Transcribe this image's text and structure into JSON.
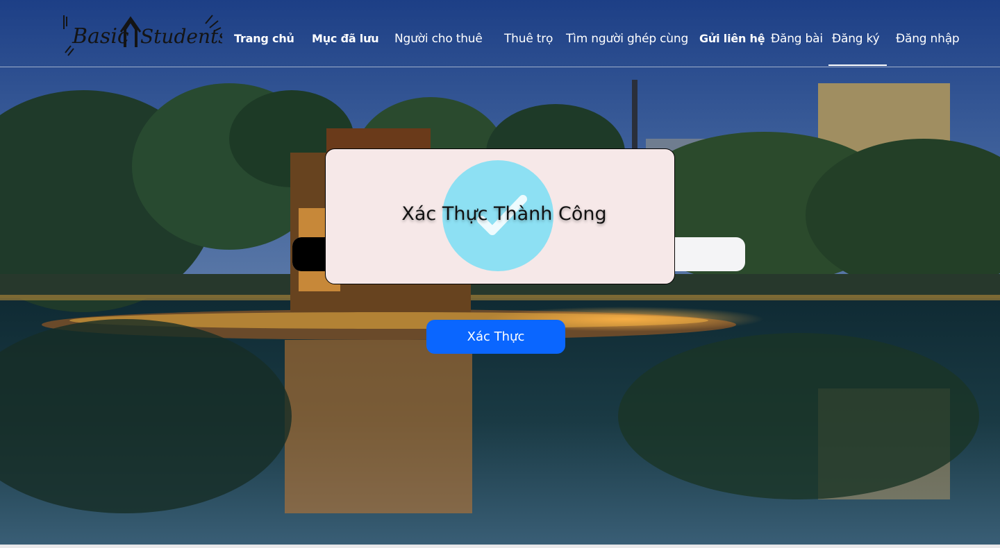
{
  "brand": {
    "logo_text": "Basic Students",
    "logo_icon": "house-icon"
  },
  "nav": {
    "items": [
      {
        "label": "Trang chủ",
        "bold": true
      },
      {
        "label": "Mục đã lưu",
        "bold": true
      },
      {
        "label": "Người cho thuê",
        "bold": false
      },
      {
        "label": "Thuê trọ",
        "bold": false
      },
      {
        "label": "Tìm người ghép cùng",
        "bold": false
      },
      {
        "label": "Gửi liên hệ",
        "bold": true
      },
      {
        "label": "Đăng bài",
        "bold": false
      },
      {
        "label": "Đăng ký",
        "bold": false,
        "active": true
      },
      {
        "label": "Đăng nhập",
        "bold": false
      }
    ]
  },
  "form": {
    "code_value": "",
    "verify_label": "Xác Thực"
  },
  "modal": {
    "title": "Xác Thực Thành Công",
    "icon": "check-icon"
  },
  "colors": {
    "primary_button": "#0a66ff",
    "modal_bg": "#f6e8e8",
    "check_circle": "#8de0f3"
  }
}
